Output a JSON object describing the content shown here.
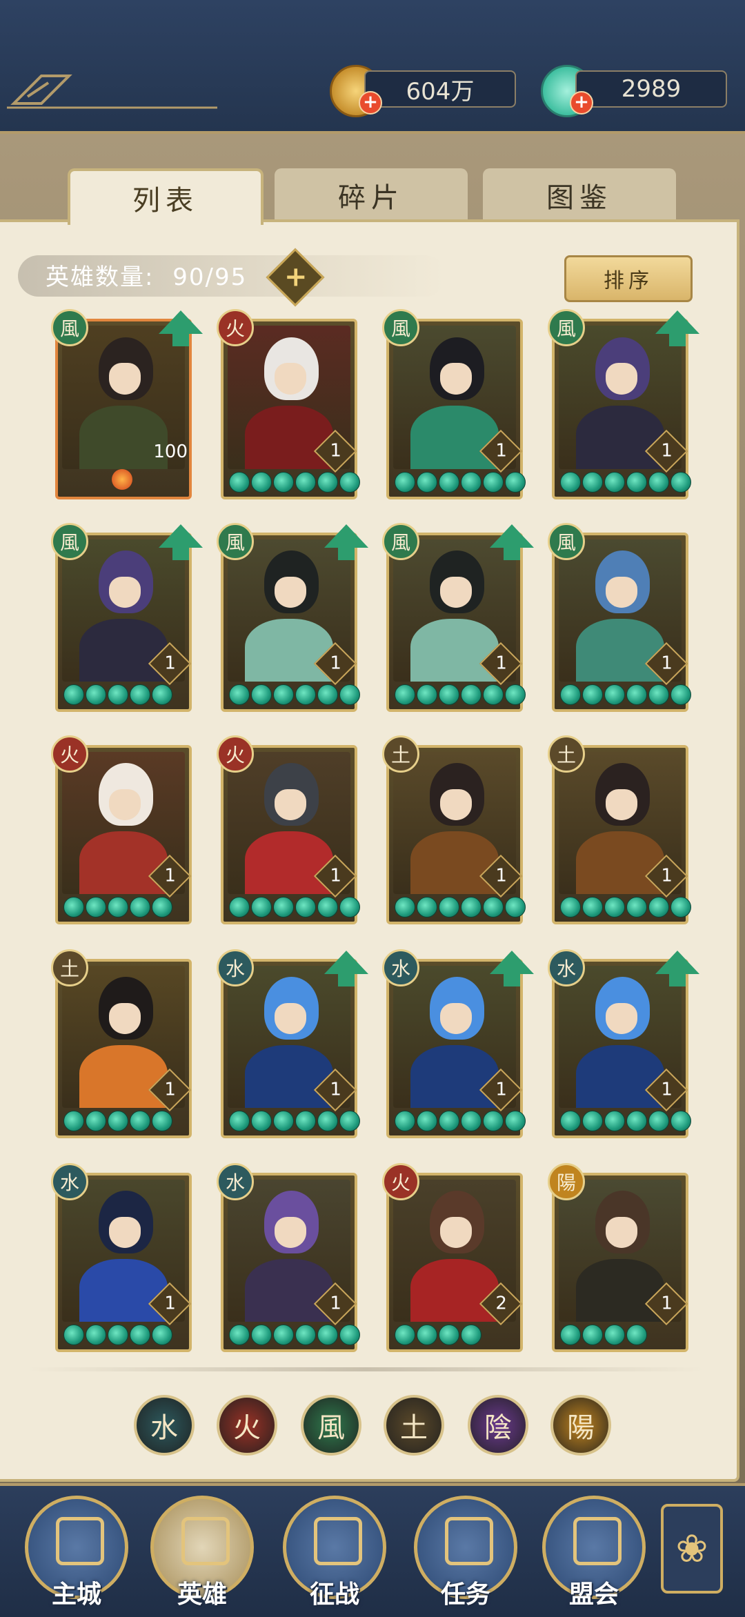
{
  "currencies": [
    {
      "name": "coin-icon",
      "value": "604万"
    },
    {
      "name": "jade-icon",
      "value": "2989"
    }
  ],
  "tabs": [
    {
      "label": "列表",
      "active": true
    },
    {
      "label": "碎片",
      "active": false
    },
    {
      "label": "图鉴",
      "active": false
    }
  ],
  "hero_count": {
    "label": "英雄数量:",
    "value": "90/95"
  },
  "sort_button": {
    "label": "排序"
  },
  "heroes": [
    {
      "element": "風",
      "level": "100",
      "upgrade": true,
      "stars": 0,
      "hair": "#2b2320",
      "outfit": "#3f4a2a",
      "bg": "#4f3f21"
    },
    {
      "element": "火",
      "level": "1",
      "upgrade": false,
      "stars": 6,
      "hair": "#e9e6e2",
      "outfit": "#7a1d1d",
      "bg": "#5b2b22"
    },
    {
      "element": "風",
      "level": "1",
      "upgrade": false,
      "stars": 6,
      "hair": "#1d1d22",
      "outfit": "#2b8a6a",
      "bg": "#4b4a2f"
    },
    {
      "element": "風",
      "level": "1",
      "upgrade": true,
      "stars": 6,
      "hair": "#4b3e7a",
      "outfit": "#2c2a3e",
      "bg": "#4a4a2c"
    },
    {
      "element": "風",
      "level": "1",
      "upgrade": true,
      "stars": 5,
      "hair": "#4b3e7a",
      "outfit": "#2c2a3e",
      "bg": "#4a4a2c"
    },
    {
      "element": "風",
      "level": "1",
      "upgrade": true,
      "stars": 6,
      "hair": "#1f2322",
      "outfit": "#7fb7a4",
      "bg": "#4d4a30"
    },
    {
      "element": "風",
      "level": "1",
      "upgrade": true,
      "stars": 6,
      "hair": "#1f2322",
      "outfit": "#7fb7a4",
      "bg": "#4d4a30"
    },
    {
      "element": "風",
      "level": "1",
      "upgrade": false,
      "stars": 6,
      "hair": "#4f7fb6",
      "outfit": "#3f8a77",
      "bg": "#4b4a30"
    },
    {
      "element": "火",
      "level": "1",
      "upgrade": false,
      "stars": 5,
      "hair": "#efe8df",
      "outfit": "#a33228",
      "bg": "#5a3a25"
    },
    {
      "element": "火",
      "level": "1",
      "upgrade": false,
      "stars": 6,
      "hair": "#3d4148",
      "outfit": "#b22b2b",
      "bg": "#4f3e28"
    },
    {
      "element": "土",
      "level": "1",
      "upgrade": false,
      "stars": 6,
      "hair": "#2b2220",
      "outfit": "#7a4a20",
      "bg": "#5a4a2a"
    },
    {
      "element": "土",
      "level": "1",
      "upgrade": false,
      "stars": 6,
      "hair": "#2b2220",
      "outfit": "#7a4a20",
      "bg": "#5a4a2a"
    },
    {
      "element": "土",
      "level": "1",
      "upgrade": false,
      "stars": 5,
      "hair": "#1f1b1a",
      "outfit": "#d9762a",
      "bg": "#574724"
    },
    {
      "element": "水",
      "level": "1",
      "upgrade": true,
      "stars": 6,
      "hair": "#4a8fe0",
      "outfit": "#1e3b7a",
      "bg": "#4b4a2c"
    },
    {
      "element": "水",
      "level": "1",
      "upgrade": true,
      "stars": 6,
      "hair": "#4a8fe0",
      "outfit": "#1e3b7a",
      "bg": "#4b4a2c"
    },
    {
      "element": "水",
      "level": "1",
      "upgrade": true,
      "stars": 6,
      "hair": "#4a8fe0",
      "outfit": "#1e3b7a",
      "bg": "#4b4a2c"
    },
    {
      "element": "水",
      "level": "1",
      "upgrade": false,
      "stars": 5,
      "hair": "#1c2644",
      "outfit": "#2a4aa8",
      "bg": "#4a472c"
    },
    {
      "element": "水",
      "level": "1",
      "upgrade": false,
      "stars": 6,
      "hair": "#6a4f9e",
      "outfit": "#3a3050",
      "bg": "#4a4530"
    },
    {
      "element": "火",
      "level": "2",
      "upgrade": false,
      "stars": 4,
      "hair": "#5a3a2a",
      "outfit": "#a72424",
      "bg": "#4a402a"
    },
    {
      "element": "陽",
      "level": "1",
      "upgrade": false,
      "stars": 4,
      "hair": "#4a3628",
      "outfit": "#2c2a22",
      "bg": "#4b4a32"
    }
  ],
  "element_filters": [
    {
      "glyph": "水",
      "color": "#2d5a5e",
      "name": "filter-water"
    },
    {
      "glyph": "火",
      "color": "#9a3226",
      "name": "filter-fire"
    },
    {
      "glyph": "風",
      "color": "#2f7a4d",
      "name": "filter-wind"
    },
    {
      "glyph": "土",
      "color": "#5c4a2a",
      "name": "filter-earth"
    },
    {
      "glyph": "陰",
      "color": "#6b3a8e",
      "name": "filter-yin"
    },
    {
      "glyph": "陽",
      "color": "#c0841f",
      "name": "filter-yang"
    }
  ],
  "element_colors": {
    "風": "#2f7a4d",
    "火": "#9a3226",
    "土": "#5c4a2a",
    "水": "#2d5a5e",
    "陽": "#c0841f",
    "陰": "#6b3a8e"
  },
  "nav": [
    {
      "label": "主城",
      "name": "nav-main-city"
    },
    {
      "label": "英雄",
      "name": "nav-heroes",
      "active": true
    },
    {
      "label": "征战",
      "name": "nav-campaign"
    },
    {
      "label": "任务",
      "name": "nav-tasks"
    },
    {
      "label": "盟会",
      "name": "nav-alliance"
    }
  ]
}
